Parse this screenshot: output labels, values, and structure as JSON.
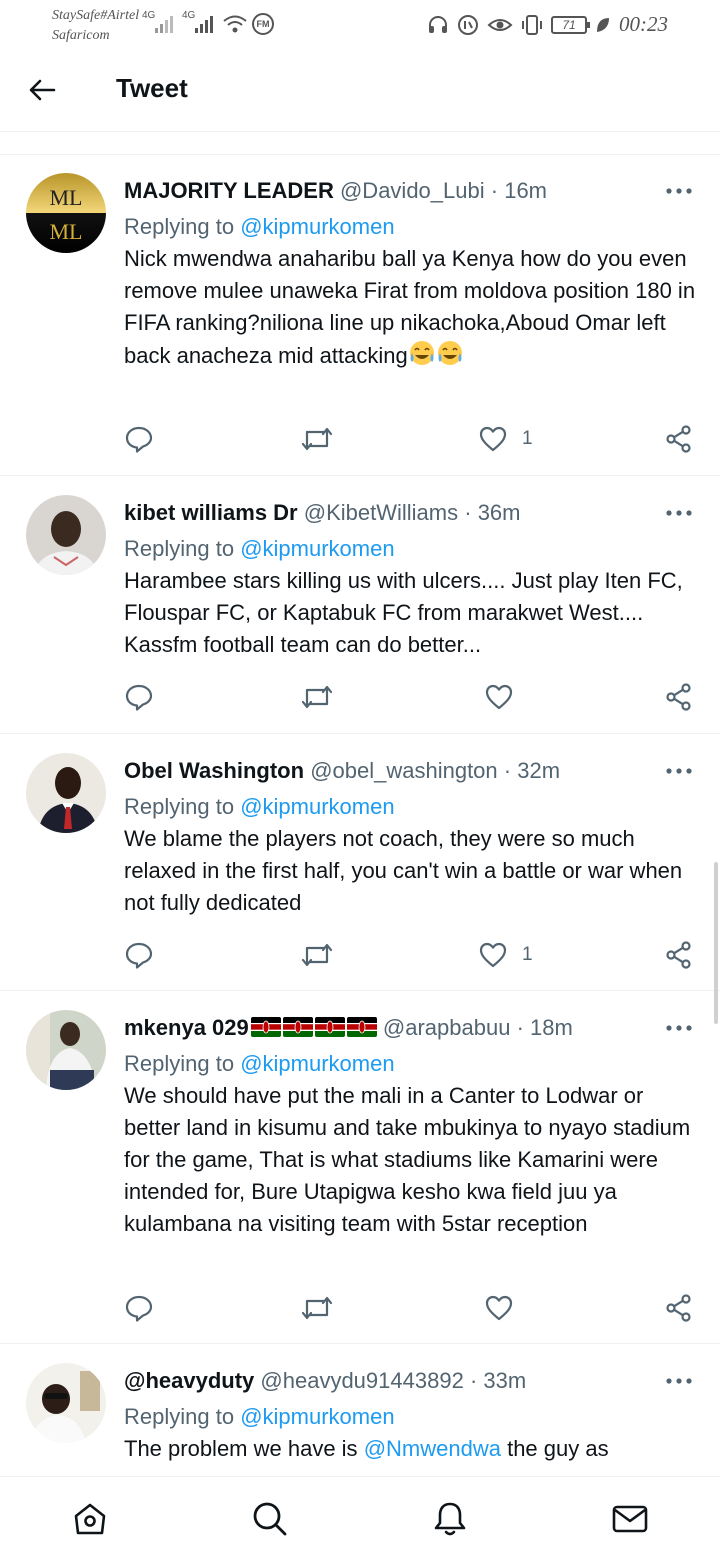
{
  "status_bar": {
    "carrier_line1": "StaySafe#Airtel",
    "carrier_line2": "Safaricom",
    "network1": "4G",
    "network2": "4G",
    "radio_label": "FM",
    "battery": "71",
    "time": "00:23"
  },
  "header": {
    "title": "Tweet"
  },
  "tweets": [
    {
      "name": "MAJORITY LEADER",
      "handle": "@Davido_Lubi",
      "separator": "·",
      "time": "16m",
      "reply_prefix": "Replying to",
      "reply_to": "@kipmurkomen",
      "text": "Nick mwendwa anaharibu ball ya Kenya how do you even remove mulee unaweka Firat from moldova position 180 in FIFA ranking?niliona line up nikachoka,Aboud Omar left back anacheza mid attacking",
      "likes": "1"
    },
    {
      "name": "kibet williams Dr",
      "handle": "@KibetWilliams",
      "separator": "·",
      "time": "36m",
      "reply_prefix": "Replying to",
      "reply_to": "@kipmurkomen",
      "text": "Harambee stars killing us with ulcers.... Just play Iten FC, Flouspar FC, or Kaptabuk FC from marakwet West.... Kassfm football team can do better...",
      "likes": ""
    },
    {
      "name": "Obel Washington",
      "handle": "@obel_washington",
      "separator": "·",
      "time": "32m",
      "reply_prefix": "Replying to",
      "reply_to": "@kipmurkomen",
      "text": "We blame the players not coach, they were so much relaxed in the first half, you can't win a battle or war when not fully dedicated",
      "likes": "1"
    },
    {
      "name": "mkenya 029",
      "handle": "@arapbabuu",
      "separator": "·",
      "time": "18m",
      "reply_prefix": "Replying to",
      "reply_to": "@kipmurkomen",
      "text": "We should have put the mali in a Canter  to Lodwar or better land in kisumu and take mbukinya to nyayo stadium for the game, That is what stadiums like Kamarini were intended for, Bure Utapigwa kesho kwa field juu ya kulambana na visiting team with 5star reception",
      "likes": ""
    },
    {
      "name": "@heavyduty",
      "handle": "@heavydu91443892",
      "separator": "·",
      "time": "33m",
      "reply_prefix": "Replying to",
      "reply_to": "@kipmurkomen",
      "text_before": "The problem we have is",
      "text_mention": "@Nmwendwa",
      "text_after": "the guy as"
    }
  ],
  "colors": {
    "accent": "#1d9bf0",
    "secondary_text": "#536471",
    "divider": "#eff3f4"
  }
}
